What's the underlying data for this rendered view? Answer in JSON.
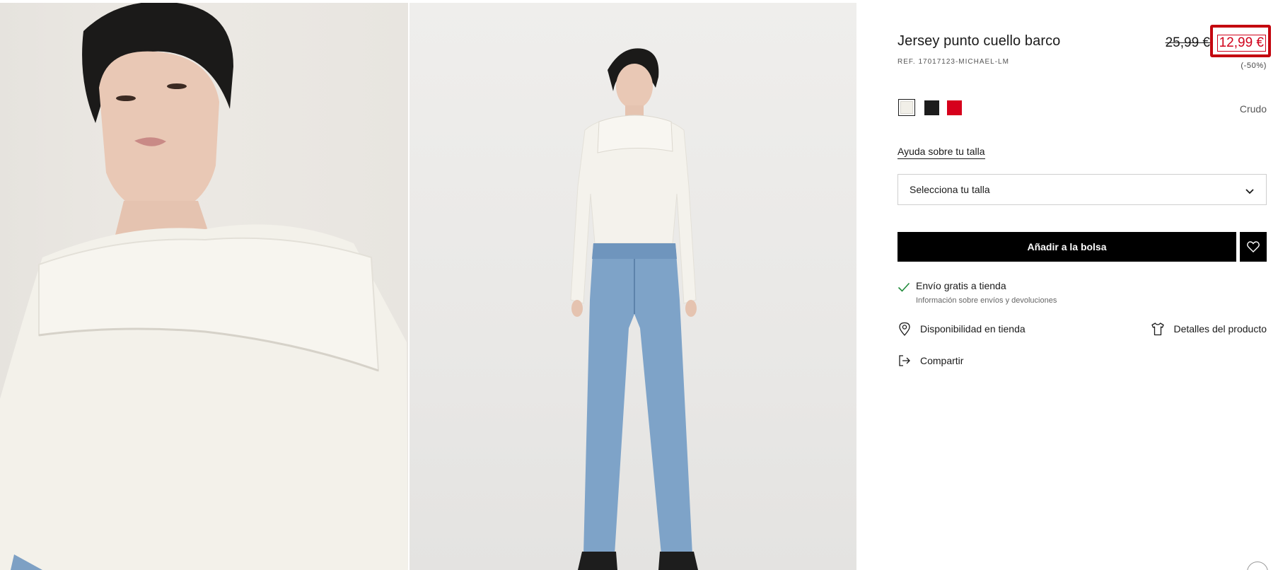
{
  "product": {
    "title": "Jersey punto cuello barco",
    "ref": "REF. 17017123-MICHAEL-LM",
    "old_price": "25,99 €",
    "new_price": "12,99 €",
    "discount": "(-50%)"
  },
  "colors": {
    "selected_name": "Crudo",
    "swatches": [
      {
        "name": "crudo",
        "hex": "#f1efe8"
      },
      {
        "name": "negro",
        "hex": "#1c1c1c"
      },
      {
        "name": "rojo",
        "hex": "#d6001c"
      }
    ]
  },
  "size": {
    "help_label": "Ayuda sobre tu talla",
    "select_label": "Selecciona tu talla"
  },
  "actions": {
    "add_to_bag": "Añadir a la bolsa"
  },
  "shipping": {
    "main": "Envío gratis a tienda",
    "sub": "Información sobre envíos y devoluciones"
  },
  "links": {
    "store_availability": "Disponibilidad en tienda",
    "product_details": "Detalles del producto",
    "share": "Compartir"
  },
  "icons": [
    "check-icon",
    "heart-icon",
    "chevron-down-icon",
    "location-pin-icon",
    "tshirt-icon",
    "share-icon"
  ],
  "theme": {
    "sale_red": "#d0021b",
    "highlight_red": "#c4060f",
    "button_black": "#000000"
  }
}
